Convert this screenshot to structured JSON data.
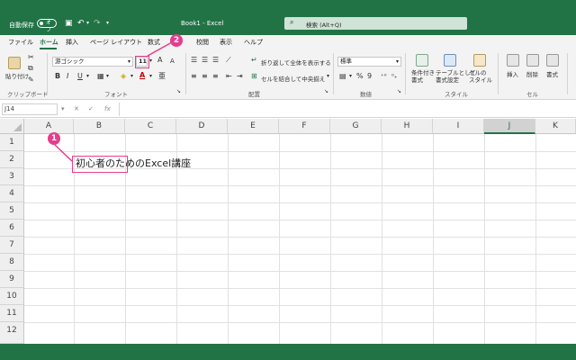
{
  "titlebar": {
    "autosave_label": "自動保存",
    "autosave_state": "オフ",
    "doc_title": "Book1 - Excel",
    "search_placeholder": "検索 (Alt+Q)"
  },
  "tabs": [
    "ファイル",
    "ホーム",
    "挿入",
    "ページ レイアウト",
    "数式",
    "校閲",
    "表示",
    "ヘルプ"
  ],
  "active_tab": "ホーム",
  "ribbon": {
    "clipboard": {
      "paste": "貼り付け",
      "label": "クリップボード"
    },
    "font": {
      "font_name": "游ゴシック",
      "font_size": "11",
      "label": "フォント",
      "grow": "A",
      "shrink": "A",
      "bold": "B",
      "italic": "I",
      "underline": "U",
      "font_color_letter": "A"
    },
    "alignment": {
      "wrap": "折り返して全体を表示する",
      "merge": "セルを結合して中央揃え",
      "label": "配置"
    },
    "number": {
      "format": "標準",
      "percent": "%",
      "comma": "9",
      "label": "数値"
    },
    "styles": {
      "conditional": "条件付き\n書式",
      "table": "テーブルとして\n書式設定",
      "cell": "セルの\nスタイル",
      "label": "スタイル"
    },
    "cells": {
      "insert": "挿入",
      "delete": "削除",
      "format": "書式",
      "label": "セル"
    }
  },
  "annotations": {
    "one": "1",
    "two": "2"
  },
  "formulabar": {
    "namebox": "J14",
    "fx": "fx"
  },
  "grid": {
    "columns": [
      "A",
      "B",
      "C",
      "D",
      "E",
      "F",
      "G",
      "H",
      "I",
      "J",
      "K"
    ],
    "selected_column": "J",
    "rows": [
      "1",
      "2",
      "3",
      "4",
      "5",
      "6",
      "7",
      "8",
      "9",
      "10",
      "11",
      "12"
    ],
    "cell_B2": "初心者のためのExcel講座"
  },
  "colors": {
    "excel_green": "#217346",
    "highlight_pink": "#e63c8c"
  }
}
